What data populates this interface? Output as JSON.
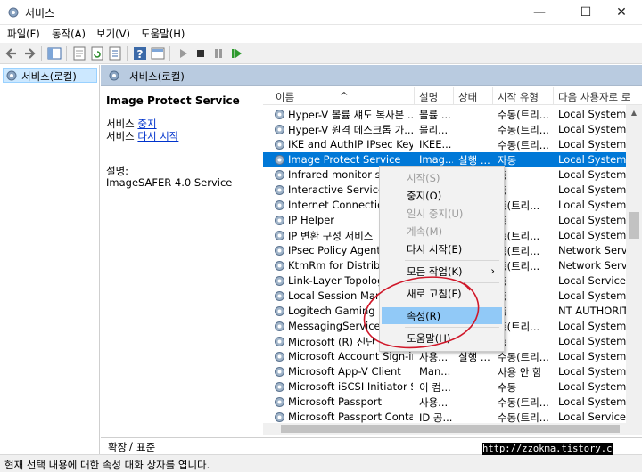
{
  "window": {
    "title": "서비스",
    "minimize": "—",
    "maximize": "☐",
    "close": "✕"
  },
  "menu": [
    "파일(F)",
    "동작(A)",
    "보기(V)",
    "도움말(H)"
  ],
  "tree": {
    "item": "서비스(로컬)"
  },
  "pane": {
    "header": "서비스(로컬)"
  },
  "detail": {
    "title": "Image Protect Service",
    "stop_prefix": "서비스 ",
    "stop_link": "중지",
    "restart_prefix": "서비스 ",
    "restart_link": "다시 시작",
    "desc_label": "설명:",
    "desc_text": "ImageSAFER 4.0 Service"
  },
  "columns": [
    "이름",
    "설명",
    "상태",
    "시작 유형",
    "다음 사용자로 로"
  ],
  "sort_indicator": "^",
  "rows": [
    {
      "name": "Hyper-V 볼륨 섀도 복사본 ...",
      "desc": "볼륨 ...",
      "state": "",
      "start": "수동(트리...",
      "logon": "Local System"
    },
    {
      "name": "Hyper-V 원격 데스크톱 가...",
      "desc": "물리...",
      "state": "",
      "start": "수동(트리...",
      "logon": "Local System"
    },
    {
      "name": "IKE and AuthIP IPsec Keyin...",
      "desc": "IKEE...",
      "state": "",
      "start": "수동(트리...",
      "logon": "Local System"
    },
    {
      "name": "Image Protect Service",
      "desc": "Imag...",
      "state": "실행 ...",
      "start": "자동",
      "logon": "Local System"
    },
    {
      "name": "Infrared monitor serv",
      "desc": "",
      "state": "",
      "start": "동",
      "logon": "Local System"
    },
    {
      "name": "Interactive Services D",
      "desc": "",
      "state": "",
      "start": "동",
      "logon": "Local System"
    },
    {
      "name": "Internet Connection S",
      "desc": "",
      "state": "",
      "start": "동(트리...",
      "logon": "Local System"
    },
    {
      "name": "IP Helper",
      "desc": "",
      "state": "",
      "start": "동",
      "logon": "Local System"
    },
    {
      "name": "IP 변환 구성 서비스",
      "desc": "",
      "state": "",
      "start": "동(트리...",
      "logon": "Local System"
    },
    {
      "name": "IPsec Policy Agent",
      "desc": "",
      "state": "",
      "start": "동(트리...",
      "logon": "Network Service"
    },
    {
      "name": "KtmRm for Distribute",
      "desc": "",
      "state": "",
      "start": "동(트리...",
      "logon": "Network Service"
    },
    {
      "name": "Link-Layer Topology",
      "desc": "",
      "state": "",
      "start": "동",
      "logon": "Local Service"
    },
    {
      "name": "Local Session Manag",
      "desc": "",
      "state": "",
      "start": "동",
      "logon": "Local System"
    },
    {
      "name": "Logitech Gaming Reg",
      "desc": "",
      "state": "",
      "start": "동",
      "logon": "NT AUTHORITY\\"
    },
    {
      "name": "MessagingService_69",
      "desc": "",
      "state": "",
      "start": "동(트리...",
      "logon": "Local System"
    },
    {
      "name": "Microsoft (R) 진단 이",
      "desc": "",
      "state": "",
      "start": "동",
      "logon": "Local System"
    },
    {
      "name": "Microsoft Account Sign-in ...",
      "desc": "사용...",
      "state": "실행 ...",
      "start": "수동(트리...",
      "logon": "Local System"
    },
    {
      "name": "Microsoft App-V Client",
      "desc": "Man...",
      "state": "",
      "start": "사용 안 함",
      "logon": "Local System"
    },
    {
      "name": "Microsoft iSCSI Initiator Se...",
      "desc": "이 컴...",
      "state": "",
      "start": "수동",
      "logon": "Local System"
    },
    {
      "name": "Microsoft Passport",
      "desc": "사용...",
      "state": "",
      "start": "수동(트리...",
      "logon": "Local System"
    },
    {
      "name": "Microsoft Passport Container",
      "desc": "ID 공...",
      "state": "",
      "start": "수동(트리...",
      "logon": "Local Service"
    }
  ],
  "context_menu": [
    {
      "label": "시작(S)",
      "disabled": true
    },
    {
      "label": "중지(O)",
      "disabled": false
    },
    {
      "label": "일시 중지(U)",
      "disabled": true
    },
    {
      "label": "계속(M)",
      "disabled": true
    },
    {
      "label": "다시 시작(E)",
      "disabled": false
    },
    {
      "label": "모든 작업(K)",
      "disabled": false,
      "submenu": true
    },
    {
      "label": "새로 고침(F)",
      "disabled": false
    },
    {
      "label": "속성(R)",
      "disabled": false,
      "highlighted": true
    },
    {
      "label": "도움말(H)",
      "disabled": false
    }
  ],
  "submenu_arrow": "›",
  "tabs": [
    "확장",
    "표준"
  ],
  "status": "현재 선택 내용에 대한 속성 대화 상자를 엽니다.",
  "watermark": "http://zzokma.tistory.com",
  "colors": {
    "selection": "#0078d7",
    "menu_highlight": "#91c9f7",
    "annotation": "#d0182a",
    "pane_header": "#b9cbe0"
  },
  "icons": [
    "services-icon",
    "back-icon",
    "forward-icon",
    "play-icon",
    "stop-icon",
    "pause-icon",
    "restart-icon",
    "gear-icon"
  ]
}
